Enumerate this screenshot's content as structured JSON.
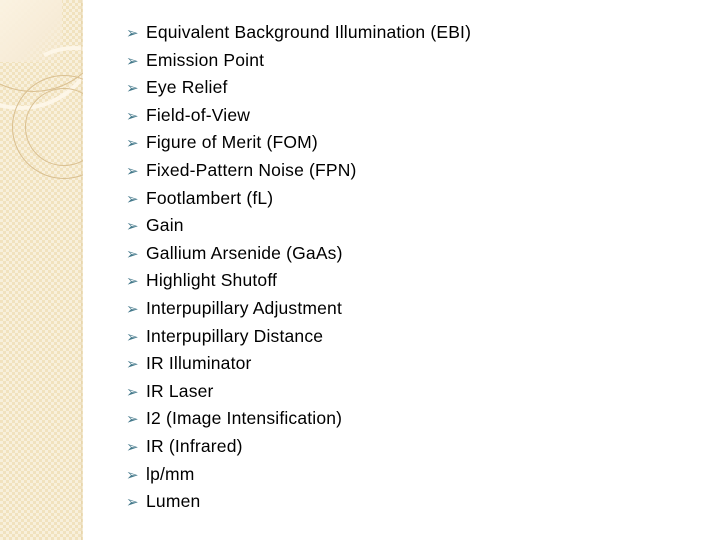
{
  "slide": {
    "background_color": "#ffffff",
    "sidebar": {
      "name": "decorative-sidebar",
      "base_color": "#f1e2be",
      "texture_highlight_color": "#fbf3e2",
      "ring_dark_color": "#d9bf90",
      "ring_light_color": "#fdf6e7"
    },
    "bullet": {
      "glyph": "➢",
      "icon_name": "arrowhead-bullet-icon",
      "color": "#44798b",
      "source_char": "Ø"
    },
    "text_color": "#000000",
    "items": [
      {
        "label": "Equivalent Background Illumination (EBI)"
      },
      {
        "label": "Emission Point"
      },
      {
        "label": "Eye Relief"
      },
      {
        "label": "Field-of-View"
      },
      {
        "label": "Figure of Merit (FOM)"
      },
      {
        "label": "Fixed-Pattern Noise (FPN)"
      },
      {
        "label": "Footlambert (fL)"
      },
      {
        "label": "Gain"
      },
      {
        "label": "Gallium Arsenide (GaAs)"
      },
      {
        "label": "Highlight Shutoff"
      },
      {
        "label": "Interpupillary Adjustment"
      },
      {
        "label": "Interpupillary Distance"
      },
      {
        "label": "IR Illuminator"
      },
      {
        "label": "IR Laser"
      },
      {
        "label": "I2 (Image Intensification)"
      },
      {
        "label": "IR (Infrared)"
      },
      {
        "label": "lp/mm"
      },
      {
        "label": "Lumen"
      }
    ]
  }
}
